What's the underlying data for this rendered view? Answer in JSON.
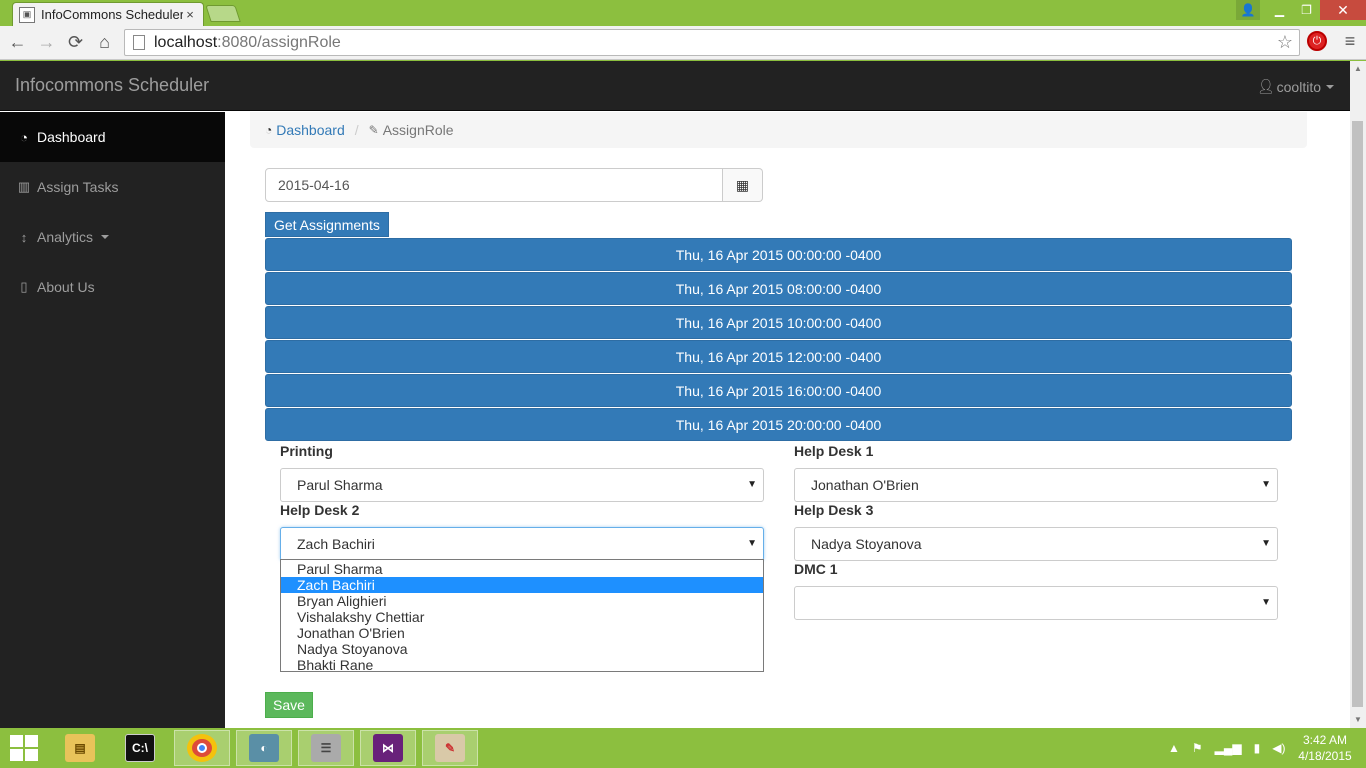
{
  "browser": {
    "tab_title": "InfoCommons Scheduler",
    "tab_close": "×",
    "url_host": "localhost",
    "url_rest": ":8080/assignRole",
    "window_controls": [
      "user-icon",
      "minimize-icon",
      "restore-icon",
      "close-icon"
    ]
  },
  "navbar": {
    "brand": "Infocommons Scheduler",
    "user": "cooltito"
  },
  "sidebar": {
    "items": [
      {
        "label": "Dashboard",
        "icon": "dashboard-icon",
        "active": true
      },
      {
        "label": "Assign Tasks",
        "icon": "bar-chart-icon",
        "active": false
      },
      {
        "label": "Analytics",
        "icon": "vertical-arrows-icon",
        "active": false,
        "has_dropdown": true
      },
      {
        "label": "About Us",
        "icon": "file-icon",
        "active": false
      }
    ]
  },
  "breadcrumb": {
    "items": [
      {
        "label": "Dashboard",
        "icon": "dashboard-icon"
      },
      {
        "label": "AssignRole",
        "icon": "edit-icon"
      }
    ],
    "separator": "/"
  },
  "form": {
    "date_value": "2015-04-16",
    "get_button": "Get Assignments",
    "save_button": "Save"
  },
  "slots": [
    "Thu, 16 Apr 2015 00:00:00 -0400",
    "Thu, 16 Apr 2015 08:00:00 -0400",
    "Thu, 16 Apr 2015 10:00:00 -0400",
    "Thu, 16 Apr 2015 12:00:00 -0400",
    "Thu, 16 Apr 2015 16:00:00 -0400",
    "Thu, 16 Apr 2015 20:00:00 -0400"
  ],
  "roles": {
    "printing": {
      "label": "Printing",
      "value": "Parul Sharma"
    },
    "help_desk_1": {
      "label": "Help Desk 1",
      "value": "Jonathan O'Brien"
    },
    "help_desk_2": {
      "label": "Help Desk 2",
      "value": "Zach Bachiri"
    },
    "help_desk_3": {
      "label": "Help Desk 3",
      "value": "Nadya Stoyanova"
    },
    "dmc_1": {
      "label": "DMC 1",
      "value": ""
    }
  },
  "dropdown_options": [
    "Parul Sharma",
    "Zach Bachiri",
    "Bryan Alighieri",
    "Vishalakshy Chettiar",
    "Jonathan O'Brien",
    "Nadya Stoyanova",
    "Bhakti Rane"
  ],
  "dropdown_selected": "Zach Bachiri",
  "taskbar": {
    "apps": [
      "file-explorer-icon",
      "command-prompt-icon",
      "chrome-icon",
      "remote-desktop-icon",
      "database-icon",
      "visual-studio-icon",
      "paint-icon"
    ],
    "time": "3:42 AM",
    "date": "4/18/2015"
  },
  "colors": {
    "primary": "#337ab7",
    "success": "#5cb85c",
    "navbar": "#222222",
    "taskbar": "#8cbf3f",
    "dropdown_highlight": "#1e90ff"
  }
}
